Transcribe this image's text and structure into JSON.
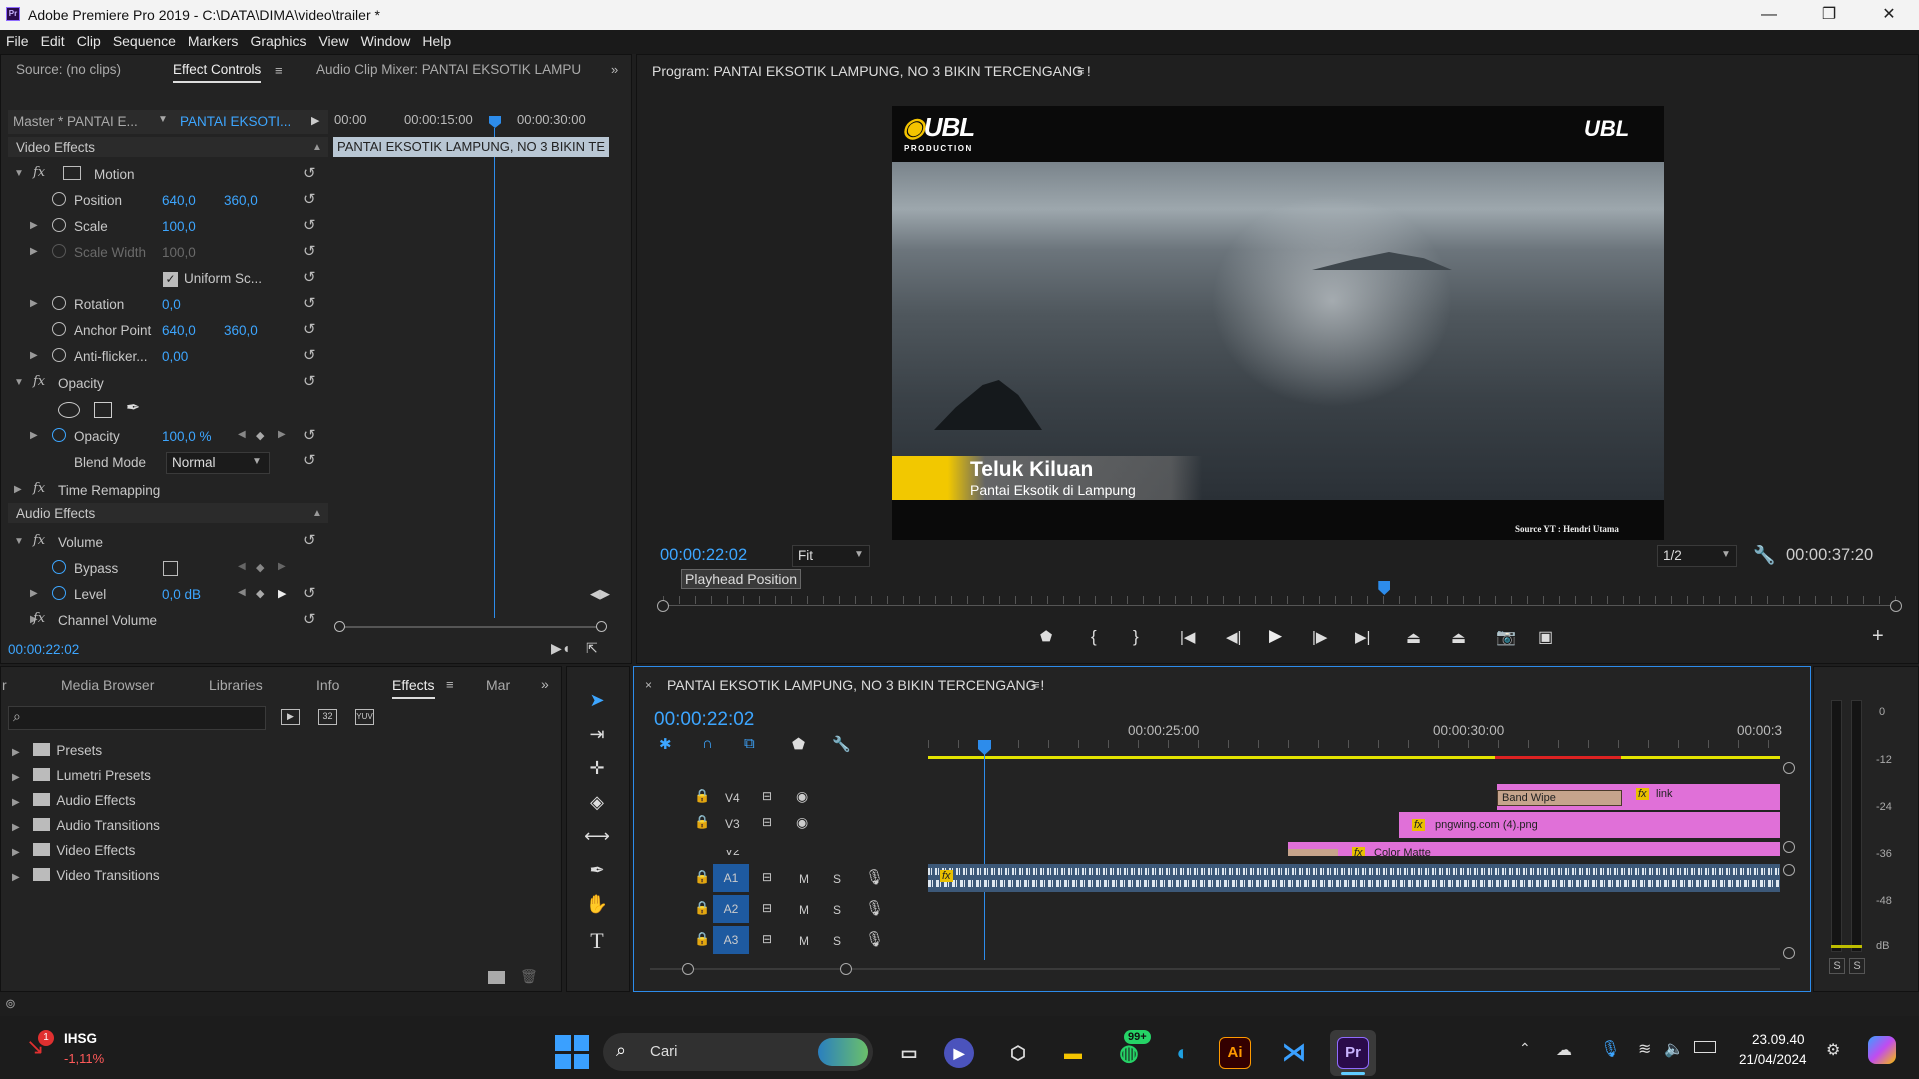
{
  "window": {
    "title": "Adobe Premiere Pro 2019 - C:\\DATA\\DIMA\\video\\trailer *",
    "app_icon": "Pr",
    "controls": {
      "minimize": "—",
      "restore": "❐",
      "close": "✕"
    }
  },
  "menu": [
    "File",
    "Edit",
    "Clip",
    "Sequence",
    "Markers",
    "Graphics",
    "View",
    "Window",
    "Help"
  ],
  "source_panel": {
    "tabs": [
      "Source: (no clips)",
      "Effect Controls",
      "Audio Clip Mixer: PANTAI EKSOTIK LAMPU"
    ],
    "master": "Master * PANTAI E...",
    "clip": "PANTAI EKSOTI...",
    "ruler": [
      "00:00",
      "00:00:15:00",
      "00:00:30:00"
    ],
    "clip_bar": "PANTAI EKSOTIK LAMPUNG, NO 3 BIKIN TE",
    "video_effects": "Video Effects",
    "motion": "Motion",
    "position": {
      "label": "Position",
      "x": "640,0",
      "y": "360,0"
    },
    "scale": {
      "label": "Scale",
      "v": "100,0"
    },
    "scale_width": {
      "label": "Scale Width",
      "v": "100,0"
    },
    "uniform": "Uniform Sc...",
    "rotation": {
      "label": "Rotation",
      "v": "0,0"
    },
    "anchor": {
      "label": "Anchor Point",
      "x": "640,0",
      "y": "360,0"
    },
    "antiflicker": {
      "label": "Anti-flicker...",
      "v": "0,00"
    },
    "opacity_group": "Opacity",
    "opacity": {
      "label": "Opacity",
      "v": "100,0 %"
    },
    "blend": {
      "label": "Blend Mode",
      "v": "Normal"
    },
    "time_remap": "Time Remapping",
    "audio_effects": "Audio Effects",
    "volume": "Volume",
    "bypass": "Bypass",
    "level": {
      "label": "Level",
      "v": "0,0 dB"
    },
    "channel_volume": "Channel Volume",
    "timecode": "00:00:22:02"
  },
  "program": {
    "title": "Program: PANTAI EKSOTIK LAMPUNG, NO 3 BIKIN TERCENGANG !",
    "timecode": "00:00:22:02",
    "fit": "Fit",
    "tooltip": "Playhead Position",
    "resolution": "1/2",
    "duration": "00:00:37:20",
    "playhead_fraction": 0.585,
    "video": {
      "logo_left": "UBL",
      "logo_sub": "PRODUCTION",
      "logo_right": "UBL",
      "lower_third_title": "Teluk Kiluan",
      "lower_third_sub": "Pantai Eksotik di Lampung",
      "credit": "Source YT : Hendri Utama"
    }
  },
  "project_panel": {
    "tabs": [
      "r",
      "Media Browser",
      "Libraries",
      "Info",
      "Effects",
      "Mar"
    ],
    "folders": [
      "Presets",
      "Lumetri Presets",
      "Audio Effects",
      "Audio Transitions",
      "Video Effects",
      "Video Transitions"
    ]
  },
  "timeline": {
    "title": "PANTAI EKSOTIK LAMPUNG, NO 3 BIKIN TERCENGANG !",
    "timecode": "00:00:22:02",
    "ruler": [
      "00:00:25:00",
      "00:00:30:00",
      "00:00:3"
    ],
    "video_tracks": [
      "V4",
      "V3",
      "V2"
    ],
    "audio_tracks": [
      "A1",
      "A2",
      "A3"
    ],
    "m": "M",
    "s": "S",
    "clips": {
      "band_wipe": "Band Wipe",
      "link": "link",
      "png": "pngwing.com (4).png",
      "matte": "Color Matte",
      "fx": "fx"
    }
  },
  "meter": {
    "scale": [
      "0",
      "-12",
      "-24",
      "-36",
      "-48",
      "dB"
    ],
    "solo": [
      "S",
      "S"
    ]
  },
  "taskbar": {
    "stock": {
      "name": "IHSG",
      "change": "-1,11%",
      "badge": "1"
    },
    "search": "Cari",
    "whatsapp_badge": "99+",
    "clock": {
      "time": "23.09.40",
      "date": "21/04/2024"
    }
  }
}
